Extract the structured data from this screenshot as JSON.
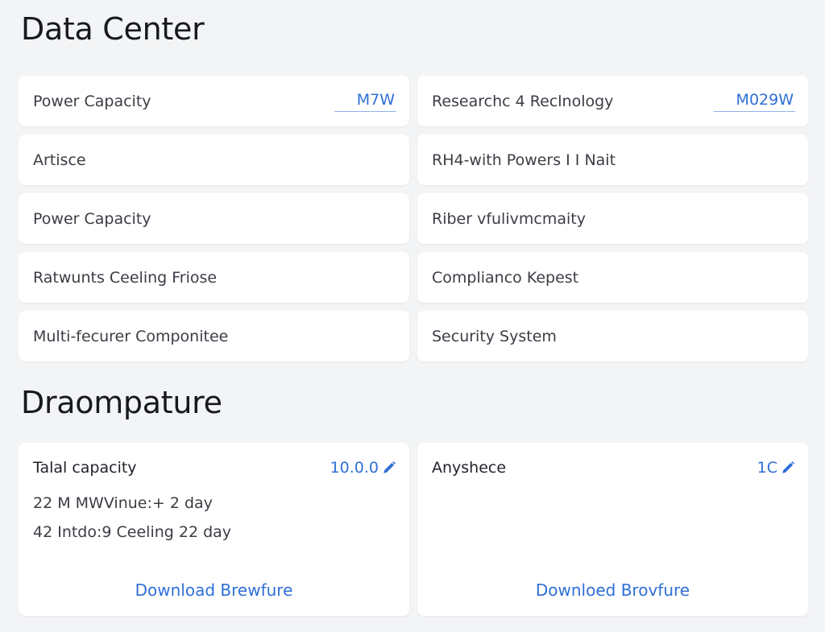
{
  "header": {
    "title": "Data Center"
  },
  "rows": [
    {
      "label": "Power Capacity",
      "value": "M7W"
    },
    {
      "label": "Researchc 4 Reclnology",
      "value": "M029W"
    },
    {
      "label": "Artisce",
      "value": ""
    },
    {
      "label": "RH4-with Powers I I Nait",
      "value": ""
    },
    {
      "label": "Power Capacity",
      "value": ""
    },
    {
      "label": "Riber vfulivmcmaity",
      "value": ""
    },
    {
      "label": "Ratwunts Ceeling Friose",
      "value": ""
    },
    {
      "label": "Complianco Kepest",
      "value": ""
    },
    {
      "label": "Multi-fecurer Componitee",
      "value": ""
    },
    {
      "label": "Security System",
      "value": ""
    }
  ],
  "section": {
    "title": "Draompature"
  },
  "cards": [
    {
      "title": "Talal capacity",
      "metric": "10.0.0",
      "lines": [
        "22 M MWVinue:+ 2 day",
        "42 Intdo:9 Ceeling 22 day"
      ],
      "link": "Download Brewfure",
      "icon": "pencil-icon"
    },
    {
      "title": "Anyshece",
      "metric": "1C",
      "lines": [],
      "link": "Downloed Brovfure",
      "icon": "pencil-icon"
    }
  ],
  "colors": {
    "accent": "#2f6fd6",
    "background": "#f3f4f6",
    "card": "#ffffff"
  }
}
